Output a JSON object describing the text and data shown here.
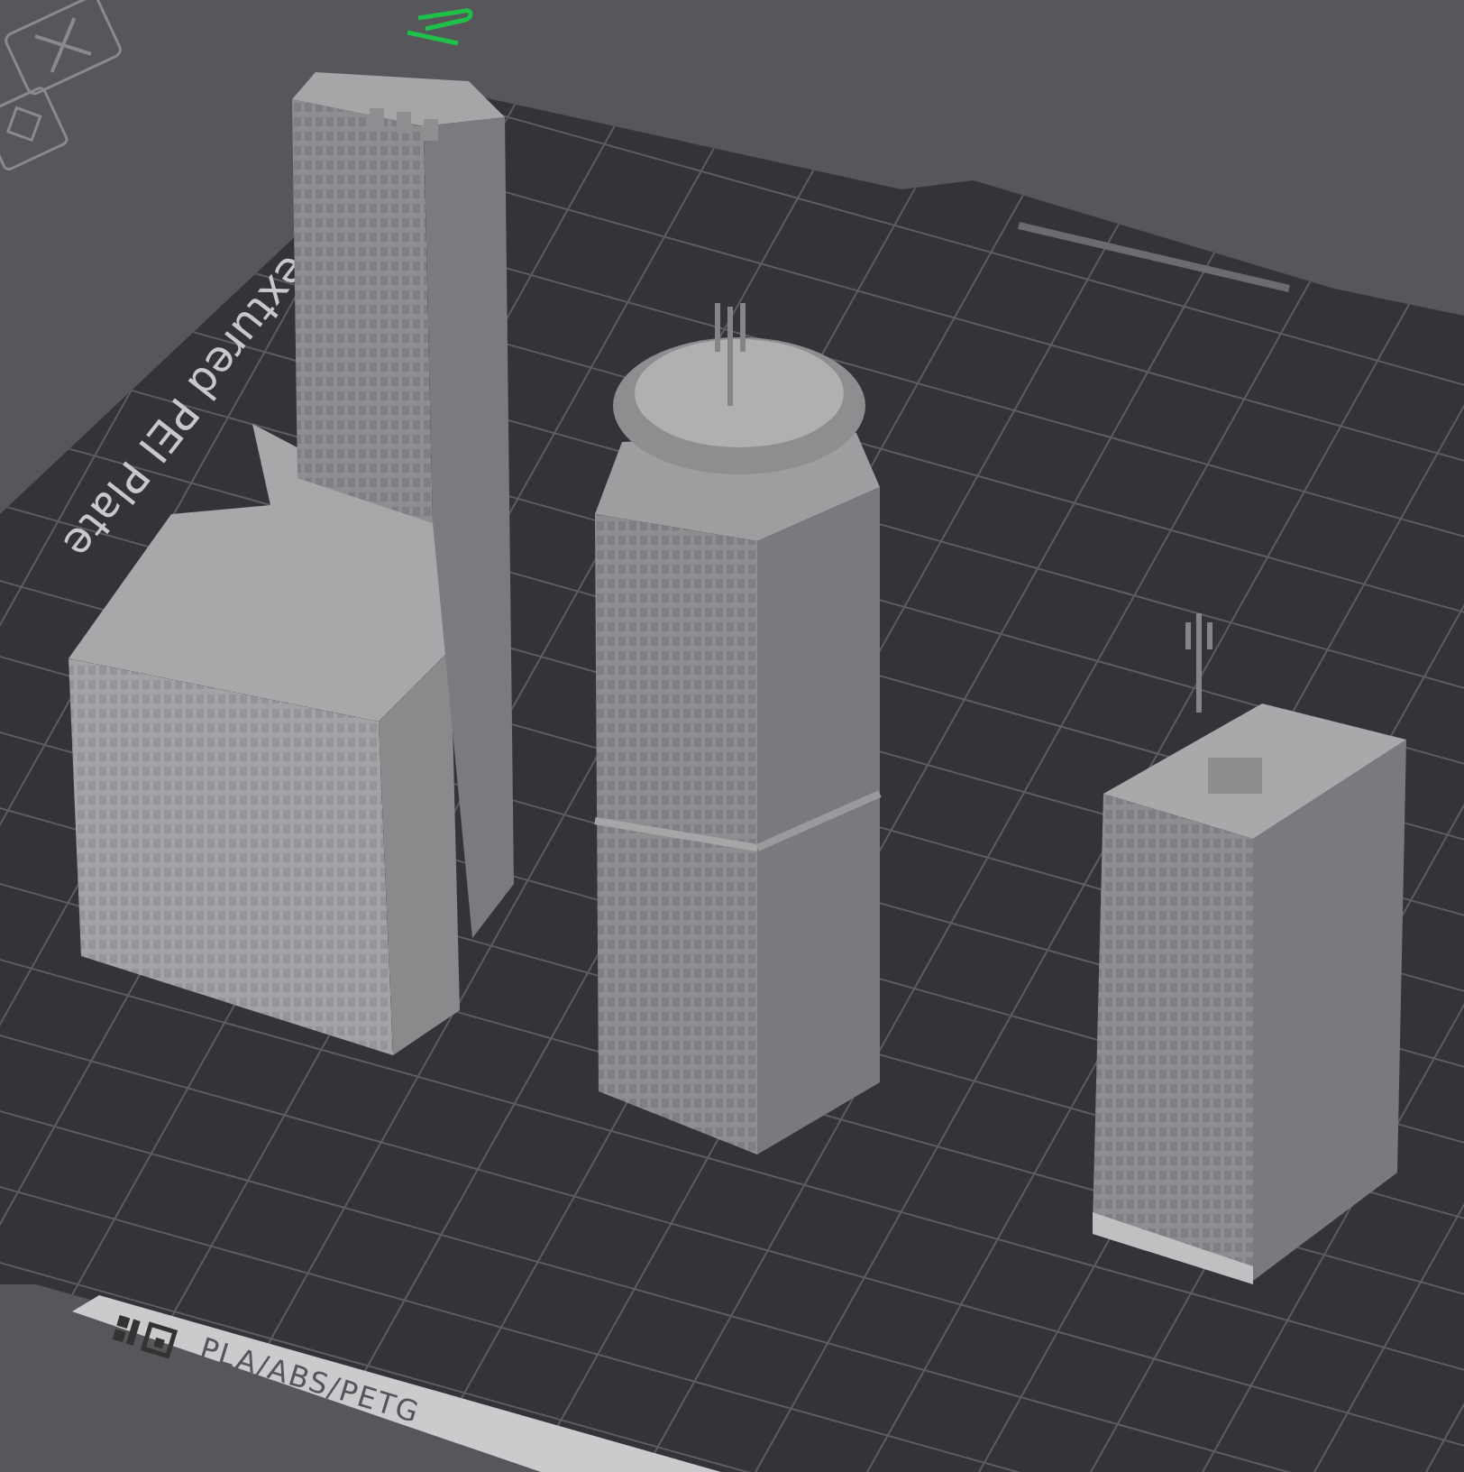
{
  "plate": {
    "name": "extured PEI Plate",
    "filament_label": "PLA/ABS/PETG"
  }
}
